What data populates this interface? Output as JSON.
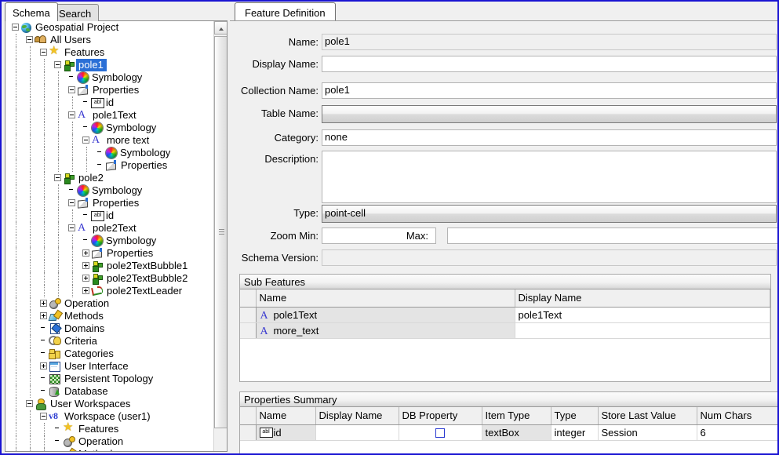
{
  "left_panel": {
    "tabs": [
      {
        "label": "Schema",
        "active": true
      },
      {
        "label": "Search",
        "active": false
      }
    ],
    "tree": [
      {
        "label": "Geospatial Project",
        "depth": 0,
        "expander": "minus",
        "icon": "globe-icon",
        "selected": false
      },
      {
        "label": "All Users",
        "depth": 1,
        "expander": "minus",
        "icon": "users-icon",
        "selected": false
      },
      {
        "label": "Features",
        "depth": 2,
        "expander": "minus",
        "icon": "star-icon",
        "selected": false
      },
      {
        "label": "pole1",
        "depth": 3,
        "expander": "minus",
        "icon": "feature-icon",
        "selected": true
      },
      {
        "label": "Symbology",
        "depth": 4,
        "expander": "none",
        "icon": "symbology-icon",
        "selected": false
      },
      {
        "label": "Properties",
        "depth": 4,
        "expander": "minus",
        "icon": "properties-icon",
        "selected": false
      },
      {
        "label": "id",
        "depth": 5,
        "expander": "none",
        "icon": "textbox-abl-icon",
        "selected": false
      },
      {
        "label": "pole1Text",
        "depth": 4,
        "expander": "minus",
        "icon": "text-feature-icon",
        "selected": false
      },
      {
        "label": "Symbology",
        "depth": 5,
        "expander": "none",
        "icon": "symbology-icon",
        "selected": false
      },
      {
        "label": "more  text",
        "depth": 5,
        "expander": "minus",
        "icon": "text-feature-icon",
        "selected": false
      },
      {
        "label": "Symbology",
        "depth": 6,
        "expander": "none",
        "icon": "symbology-icon",
        "selected": false
      },
      {
        "label": "Properties",
        "depth": 6,
        "expander": "none",
        "icon": "properties-icon",
        "selected": false
      },
      {
        "label": "pole2",
        "depth": 3,
        "expander": "minus",
        "icon": "feature-icon",
        "selected": false
      },
      {
        "label": "Symbology",
        "depth": 4,
        "expander": "none",
        "icon": "symbology-icon",
        "selected": false
      },
      {
        "label": "Properties",
        "depth": 4,
        "expander": "minus",
        "icon": "properties-icon",
        "selected": false
      },
      {
        "label": "id",
        "depth": 5,
        "expander": "none",
        "icon": "textbox-abl-icon",
        "selected": false
      },
      {
        "label": "pole2Text",
        "depth": 4,
        "expander": "minus",
        "icon": "text-feature-icon",
        "selected": false
      },
      {
        "label": "Symbology",
        "depth": 5,
        "expander": "none",
        "icon": "symbology-icon",
        "selected": false
      },
      {
        "label": "Properties",
        "depth": 5,
        "expander": "plus",
        "icon": "properties-icon",
        "selected": false
      },
      {
        "label": "pole2TextBubble1",
        "depth": 5,
        "expander": "plus",
        "icon": "feature-icon",
        "selected": false
      },
      {
        "label": "pole2TextBubble2",
        "depth": 5,
        "expander": "plus",
        "icon": "feature-icon",
        "selected": false
      },
      {
        "label": "pole2TextLeader",
        "depth": 5,
        "expander": "plus",
        "icon": "leader-icon",
        "selected": false
      },
      {
        "label": "Operation",
        "depth": 2,
        "expander": "plus",
        "icon": "gear-icon",
        "selected": false
      },
      {
        "label": "Methods",
        "depth": 2,
        "expander": "plus",
        "icon": "methods-icon",
        "selected": false
      },
      {
        "label": "Domains",
        "depth": 2,
        "expander": "none",
        "icon": "domains-icon",
        "selected": false
      },
      {
        "label": "Criteria",
        "depth": 2,
        "expander": "none",
        "icon": "criteria-icon",
        "selected": false
      },
      {
        "label": "Categories",
        "depth": 2,
        "expander": "none",
        "icon": "categories-icon",
        "selected": false
      },
      {
        "label": "User Interface",
        "depth": 2,
        "expander": "plus",
        "icon": "user-interface-icon",
        "selected": false
      },
      {
        "label": "Persistent Topology",
        "depth": 2,
        "expander": "none",
        "icon": "topology-icon",
        "selected": false
      },
      {
        "label": "Database",
        "depth": 2,
        "expander": "none",
        "icon": "database-icon",
        "selected": false
      },
      {
        "label": "User Workspaces",
        "depth": 1,
        "expander": "minus",
        "icon": "user-workspace-icon",
        "selected": false
      },
      {
        "label": "Workspace (user1)",
        "depth": 2,
        "expander": "minus",
        "icon": "v8-icon",
        "selected": false
      },
      {
        "label": "Features",
        "depth": 3,
        "expander": "none",
        "icon": "star-icon",
        "selected": false
      },
      {
        "label": "Operation",
        "depth": 3,
        "expander": "none",
        "icon": "gear-icon",
        "selected": false
      },
      {
        "label": "Methods",
        "depth": 3,
        "expander": "none",
        "icon": "methods-icon",
        "selected": false
      }
    ],
    "scrollbar": {
      "up_arrow": "scroll-up-arrow"
    }
  },
  "right_panel": {
    "tab": {
      "label": "Feature Definition"
    },
    "fields": [
      {
        "label": "Name:",
        "value": "pole1",
        "style": "readonly"
      },
      {
        "label": "Display Name:",
        "value": "",
        "style": "text"
      },
      {
        "label": "Collection Name:",
        "value": "pole1",
        "style": "text"
      },
      {
        "label": "Table Name:",
        "value": "",
        "style": "combo"
      },
      {
        "label": "Category:",
        "value": "none",
        "style": "text"
      },
      {
        "label": "Description:",
        "value": "",
        "style": "textarea"
      },
      {
        "label": "Type:",
        "value": "point-cell",
        "style": "combo"
      },
      {
        "label": "Zoom Min:",
        "value": "",
        "style": "text"
      },
      {
        "label": "Max:",
        "value": "",
        "style": "text"
      },
      {
        "label": "Schema Version:",
        "value": "",
        "style": "readonly"
      }
    ],
    "sub_features": {
      "caption": "Sub Features",
      "columns": [
        "",
        "Name",
        "Display Name"
      ],
      "rows": [
        {
          "icon": "text-feature-icon",
          "name": "pole1Text",
          "display_name": "pole1Text"
        },
        {
          "icon": "text-feature-icon",
          "name": "more_text",
          "display_name": ""
        }
      ]
    },
    "properties_summary": {
      "caption": "Properties Summary",
      "columns": [
        "",
        "Name",
        "Display Name",
        "DB Property",
        "Item Type",
        "Type",
        "Store Last Value",
        "Num Chars"
      ],
      "rows": [
        {
          "icon": "textbox-abl-icon",
          "name": "id",
          "display_name": "",
          "db_property": false,
          "item_type": "textBox",
          "type": "integer",
          "store_last_value": "Session",
          "num_chars": "6"
        }
      ]
    }
  },
  "colors": {
    "window_border": "#1a14d2",
    "selection": "#2a6fd6",
    "panel_bg": "#f0f0f0"
  }
}
